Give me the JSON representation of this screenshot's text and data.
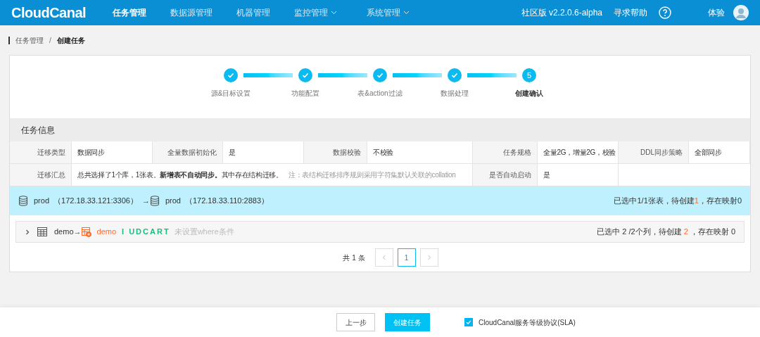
{
  "header": {
    "logo": "CloudCanal",
    "nav": [
      {
        "label": "任务管理",
        "selected": true,
        "dropdown": false
      },
      {
        "label": "数据源管理",
        "selected": false,
        "dropdown": false
      },
      {
        "label": "机器管理",
        "selected": false,
        "dropdown": false
      },
      {
        "label": "监控管理",
        "selected": false,
        "dropdown": true
      },
      {
        "label": "系统管理",
        "selected": false,
        "dropdown": true
      }
    ],
    "version": "社区版 v2.2.0.6-alpha",
    "help": "寻求帮助",
    "user": "体验"
  },
  "breadcrumb": [
    {
      "label": "任务管理",
      "current": false
    },
    {
      "label": "创建任务",
      "current": true
    }
  ],
  "breadcrumb_separator": "/",
  "steps": [
    {
      "label": "源&目标设置",
      "done": true
    },
    {
      "label": "功能配置",
      "done": true
    },
    {
      "label": "表&action过滤",
      "done": true
    },
    {
      "label": "数据处理",
      "done": true
    },
    {
      "label": "创建确认",
      "done": false,
      "number": "5"
    }
  ],
  "section_title": "任务信息",
  "info_rows": [
    [
      {
        "kind": "normal",
        "label": "迁移类型",
        "value": "数据同步"
      },
      {
        "kind": "normal",
        "label": "全量数据初始化",
        "value": "是"
      },
      {
        "kind": "normal",
        "label": "数据校验",
        "value": "不校验"
      },
      {
        "kind": "normal",
        "label": "任务规格",
        "value": "全量2G，增量2G，校验"
      },
      {
        "kind": "normal",
        "label": "DDL同步策略",
        "value": "全部同步"
      }
    ],
    [
      {
        "kind": "wide",
        "label": "迁移汇总",
        "value": "总共选择了1个库，1张表。**新增表不自动同步。**其中存在结构迁移。",
        "note": "注：表结构迁移排序规则采用字符集默认关联的collation"
      },
      {
        "kind": "normal",
        "label": "是否自动启动",
        "value": "是"
      },
      {
        "kind": "empty"
      }
    ]
  ],
  "db_mapping": {
    "source": "prod",
    "source_addr": "（172.18.33.121:3306）",
    "arrow": "→",
    "target": "prod",
    "target_addr": "（172.18.33.110:2883）",
    "status": [
      {
        "text": "已选中1/1张表，待创建",
        "highlight": false
      },
      {
        "text": "1",
        "highlight": true
      },
      {
        "text": "，存在映射0",
        "highlight": false
      }
    ]
  },
  "table_rows": [
    {
      "expanded": false,
      "source": "demo",
      "arrow": "→",
      "target": "demo",
      "actions": "I UDCART",
      "filter": "未设置where条件",
      "status": [
        {
          "text": "已选中 2 /2个列，待创建 ",
          "highlight": false
        },
        {
          "text": "2",
          "highlight": true
        },
        {
          "text": " ，存在映射 0",
          "highlight": false
        }
      ]
    }
  ],
  "pagination": {
    "total": "共 1 条",
    "pages": [
      {
        "label": "1",
        "selected": true
      }
    ]
  },
  "footer": {
    "prev": "上一步",
    "create": "创建任务",
    "agreement": {
      "label": "CloudCanal服务等级协议(SLA)",
      "checked": true
    }
  }
}
